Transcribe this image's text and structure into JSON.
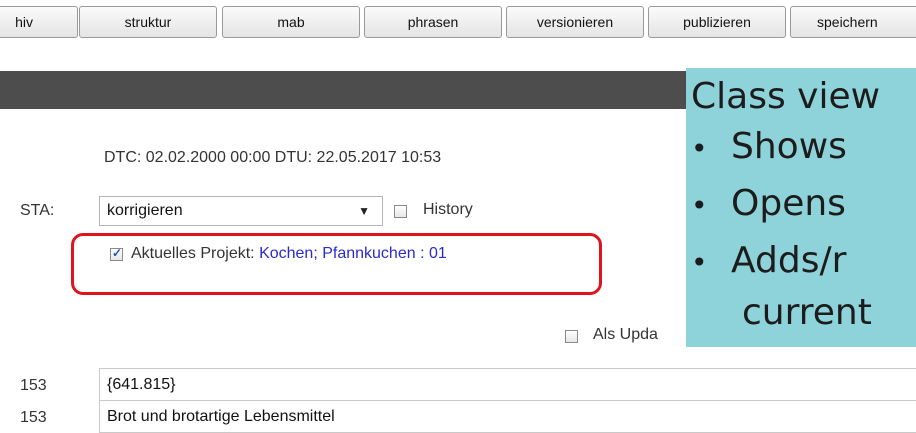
{
  "toolbar": {
    "buttons": [
      "hiv",
      "struktur",
      "mab",
      "phrasen",
      "versionieren",
      "publizieren",
      "speichern"
    ]
  },
  "record": {
    "dates": "DTC: 02.02.2000 00:00 DTU: 22.05.2017 10:53",
    "sta_label": "STA:",
    "sta_value": "korrigieren",
    "history_label": "History",
    "project_label": "Aktuelles Projekt:",
    "project_value": "Kochen; Pfannkuchen : 01",
    "project_checked": true,
    "update_label": "Als Upda"
  },
  "fields": [
    {
      "label": "153",
      "value": "{641.815}"
    },
    {
      "label": "153",
      "value": "Brot und brotartige Lebensmittel"
    }
  ],
  "overlay": {
    "title": "Class view",
    "bullets": [
      "Shows",
      "Opens",
      "Adds/r"
    ],
    "continuation": "current"
  },
  "colors": {
    "highlight_border": "#e0141e",
    "overlay_bg": "#8fd3da",
    "link_blue": "#2a2ad0"
  }
}
